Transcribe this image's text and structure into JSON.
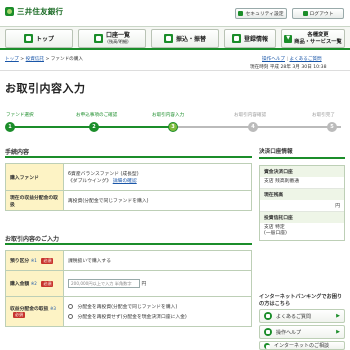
{
  "header": {
    "bank_name": "三井住友銀行",
    "security_label": "セキュリティ設定",
    "logout_label": "ログアウト"
  },
  "nav": {
    "top": "トップ",
    "account_main": "口座一覧",
    "account_sub": "(残高/明細)",
    "transfer": "振込・振替",
    "registration": "登録情報",
    "various_main": "各種変更",
    "various_sub": "商品・サービス一覧"
  },
  "breadcrumb": {
    "top": "トップ",
    "investment_trust": "投資信託",
    "current": "ファンドの購入",
    "sep": ">"
  },
  "help": {
    "operation_help": "操作ヘルプ",
    "faq": "よくあるご質問",
    "sep": "|"
  },
  "datetime_text": "現在時刻 平成 28年 3月 30日 10:38",
  "page_title": "お取引内容入力",
  "steps": [
    {
      "label": "ファンド選択",
      "num": "1"
    },
    {
      "label": "お申込事項のご確認",
      "num": "2"
    },
    {
      "label": "お取引内容入力",
      "num": "3"
    },
    {
      "label": "お取引内容確認",
      "num": "4"
    },
    {
      "label": "お取引完了",
      "num": "5"
    }
  ],
  "section_procedure": "手続内容",
  "procedure": {
    "fund_label": "購入ファンド",
    "fund_value": "6資産バランスファンド (成長型)",
    "fund_value2": "《ダブルウイング》",
    "fund_detail_link": "詳細の確認",
    "dist_label": "現在の収益分配金の取扱",
    "dist_value": "再投資(分配金で同じファンドを購入)"
  },
  "section_trade": "お取引内容のご入力",
  "trade": {
    "account_type_label": "預り区分",
    "account_type_value": "課税扱いで購入する",
    "amount_label": "購入金額",
    "amount_placeholder": "200,000円以上で入力 半角数字",
    "amount_unit": "円",
    "dist_method_label": "収益分配金の取扱",
    "dist_opt1": "分配金を再投資(分配金で同じファンドを購入)",
    "dist_opt2": "分配金を再投資せず(分配金を現金決済口座に入金)",
    "required": "必須",
    "note_hint": "※1",
    "note_hint2": "※2",
    "note_hint3": "※3"
  },
  "side": {
    "header": "決済口座情報",
    "settle_label": "資金決済口座",
    "settle_value1": "支店 残高則番通",
    "settle_value2": "",
    "balance_label": "現在残高",
    "balance_unit": "円",
    "trust_label": "投資信託口座",
    "trust_value1": "支店 特定",
    "trust_value2": "(一般口座)"
  },
  "ib": {
    "title": "インターネットバンキングでお困りの方はこちら",
    "faq": "よくあるご質問",
    "help": "操作ヘルプ",
    "contact": "インターネットのご相談"
  }
}
